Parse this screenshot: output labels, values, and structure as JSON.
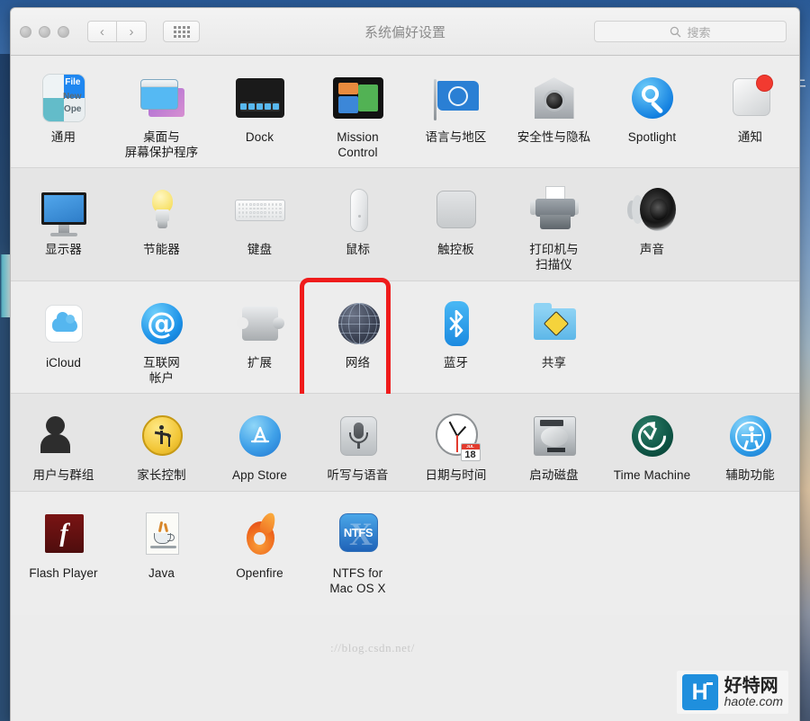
{
  "window": {
    "title": "系统偏好设置",
    "traffic_lights": [
      "close",
      "minimize",
      "zoom"
    ],
    "nav": {
      "back_label": "‹",
      "forward_label": "›"
    },
    "grid_button_name": "show-all-grid",
    "search": {
      "placeholder": "搜索",
      "icon": "search-icon"
    }
  },
  "rows": [
    {
      "name": "personal",
      "items": [
        {
          "label": "通用",
          "icon": "general-icon",
          "two_line": false
        },
        {
          "label": "桌面与\n屏幕保护程序",
          "icon": "desktop-screensaver-icon",
          "two_line": true
        },
        {
          "label": "Dock",
          "icon": "dock-icon",
          "two_line": false
        },
        {
          "label": "Mission\nControl",
          "icon": "mission-control-icon",
          "two_line": true
        },
        {
          "label": "语言与地区",
          "icon": "language-region-icon",
          "two_line": false
        },
        {
          "label": "安全性与隐私",
          "icon": "security-privacy-icon",
          "two_line": false
        },
        {
          "label": "Spotlight",
          "icon": "spotlight-icon",
          "two_line": false
        },
        {
          "label": "通知",
          "icon": "notifications-icon",
          "two_line": false,
          "badge": true
        }
      ]
    },
    {
      "name": "hardware",
      "items": [
        {
          "label": "显示器",
          "icon": "displays-icon",
          "two_line": false
        },
        {
          "label": "节能器",
          "icon": "energy-saver-icon",
          "two_line": false
        },
        {
          "label": "键盘",
          "icon": "keyboard-icon",
          "two_line": false
        },
        {
          "label": "鼠标",
          "icon": "mouse-icon",
          "two_line": false
        },
        {
          "label": "触控板",
          "icon": "trackpad-icon",
          "two_line": false
        },
        {
          "label": "打印机与\n扫描仪",
          "icon": "printers-scanners-icon",
          "two_line": true
        },
        {
          "label": "声音",
          "icon": "sound-icon",
          "two_line": false
        }
      ]
    },
    {
      "name": "internet-wireless",
      "items": [
        {
          "label": "iCloud",
          "icon": "icloud-icon",
          "two_line": false
        },
        {
          "label": "互联网\n帐户",
          "icon": "internet-accounts-icon",
          "two_line": true
        },
        {
          "label": "扩展",
          "icon": "extensions-icon",
          "two_line": false
        },
        {
          "label": "网络",
          "icon": "network-icon",
          "two_line": false,
          "highlighted": true
        },
        {
          "label": "蓝牙",
          "icon": "bluetooth-icon",
          "two_line": false
        },
        {
          "label": "共享",
          "icon": "sharing-icon",
          "two_line": false
        }
      ]
    },
    {
      "name": "system",
      "items": [
        {
          "label": "用户与群组",
          "icon": "users-groups-icon",
          "two_line": false
        },
        {
          "label": "家长控制",
          "icon": "parental-controls-icon",
          "two_line": false
        },
        {
          "label": "App Store",
          "icon": "app-store-icon",
          "two_line": false
        },
        {
          "label": "听写与语音",
          "icon": "dictation-speech-icon",
          "two_line": false
        },
        {
          "label": "日期与时间",
          "icon": "date-time-icon",
          "two_line": false
        },
        {
          "label": "启动磁盘",
          "icon": "startup-disk-icon",
          "two_line": false
        },
        {
          "label": "Time Machine",
          "icon": "time-machine-icon",
          "two_line": false
        },
        {
          "label": "辅助功能",
          "icon": "accessibility-icon",
          "two_line": false
        }
      ]
    },
    {
      "name": "other",
      "items": [
        {
          "label": "Flash Player",
          "icon": "flash-player-icon",
          "two_line": false
        },
        {
          "label": "Java",
          "icon": "java-icon",
          "two_line": false
        },
        {
          "label": "Openfire",
          "icon": "openfire-icon",
          "two_line": false
        },
        {
          "label": "NTFS for\nMac OS X",
          "icon": "ntfs-for-mac-icon",
          "two_line": true
        }
      ]
    }
  ],
  "icon_text": {
    "general_file": "File",
    "general_new": "New",
    "general_open": "Ope",
    "at_symbol": "@",
    "bluetooth_glyph": "ᛦ",
    "appstore_glyph": "A",
    "flash_glyph": "f",
    "ntfs_label": "NTFS",
    "ntfs_x": "X",
    "calendar_month": "JUL",
    "calendar_day": "18"
  },
  "annotations": {
    "highlight_target": "网络",
    "highlight_color": "#ef1b1b"
  },
  "watermarks": {
    "blog_url": "://blog.csdn.net/",
    "brand_cn": "好特网",
    "brand_en": "haote.com",
    "brand_badge": "H"
  },
  "desktop": {
    "partial_char": "干"
  },
  "colors": {
    "window_bg": "#ececec",
    "row_alt_bg": "#e5e5e5",
    "title_text": "#8b8b8b",
    "label_text": "#1b1b1b",
    "accent_red": "#ef1b1b",
    "badge_blue": "#1f8fdd"
  }
}
